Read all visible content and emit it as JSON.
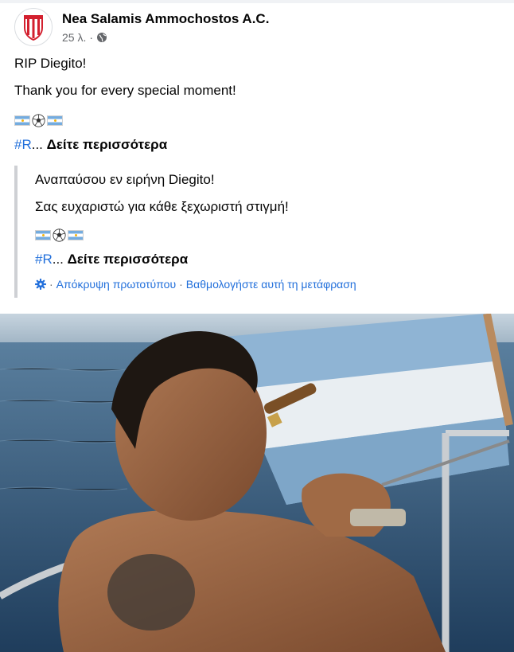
{
  "post": {
    "page_name": "Nea Salamis Ammochostos A.C.",
    "timestamp": "25 λ.",
    "dot": "·",
    "audience_icon": "globe-icon",
    "lines": [
      "RIP Diegito!",
      "Thank you for every special moment!"
    ],
    "emoji_row": [
      "argentina-flag-icon",
      "soccer-ball-icon",
      "argentina-flag-icon"
    ],
    "hashtag": "#R",
    "ellipsis": "...",
    "see_more": "Δείτε περισσότερα"
  },
  "translation": {
    "lines": [
      "Αναπαύσου εν ειρήνη Diegito!",
      "Σας ευχαριστώ για κάθε ξεχωριστή στιγμή!"
    ],
    "hashtag": "#R",
    "ellipsis": "...",
    "see_more": "Δείτε περισσότερα",
    "settings_icon": "gear-icon",
    "hide_original": "Απόκρυψη πρωτοτύπου",
    "rate_translation": "Βαθμολογήστε αυτή τη μετάφραση",
    "separator": "·"
  },
  "photo": {
    "subject": "man-smoking-cigar-on-sailboat-photo",
    "flag_icon": "argentina-flag-sail"
  },
  "colors": {
    "link_blue": "#216fdb",
    "meta_gray": "#65676b",
    "quote_border": "#ced0d4",
    "argentina_blue": "#74acdf",
    "club_red": "#d3202f"
  }
}
